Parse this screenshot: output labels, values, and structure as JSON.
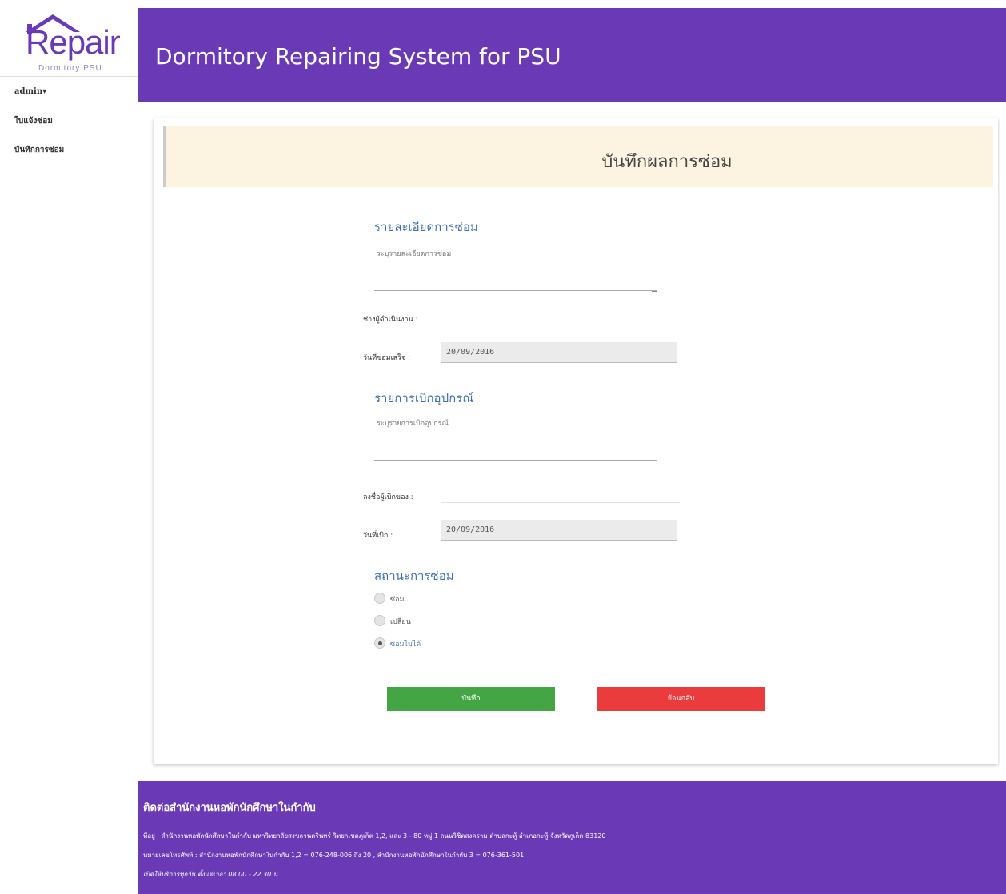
{
  "brand": {
    "logo_text": "Repair",
    "logo_subtext": "Dormitory PSU"
  },
  "sidebar": {
    "user": "admin▾",
    "items": [
      {
        "label": "ใบแจ้งซ่อม"
      },
      {
        "label": "บันทึกการซ่อม"
      }
    ]
  },
  "header": {
    "title": "Dormitory Repairing System for PSU"
  },
  "form": {
    "title": "บันทึกผลการซ่อม",
    "repair_details": {
      "heading": "รายละเอียดการซ่อม",
      "placeholder": "ระบุรายละเอียดการซ่อม"
    },
    "technician": {
      "label": "ช่างผู้ดำเนินงาน :",
      "value": ""
    },
    "repair_done_date": {
      "label": "วันที่ซ่อมเสร็จ :",
      "value": "20/09/2016"
    },
    "equipment_list": {
      "heading": "รายการเบิกอุปกรณ์",
      "placeholder": "ระบุรายการเบิกอุปกรณ์"
    },
    "withdrawer": {
      "label": "ลงชื่อผู้เบิกของ :",
      "value": ""
    },
    "withdraw_date": {
      "label": "วันที่เบิก :",
      "value": "20/09/2016"
    },
    "status": {
      "heading": "สถานะการซ่อม",
      "options": [
        {
          "label": "ซ่อม",
          "checked": false
        },
        {
          "label": "เปลี่ยน",
          "checked": false
        },
        {
          "label": "ซ่อมไม่ได้",
          "checked": true
        }
      ]
    },
    "buttons": {
      "save": "บันทึก",
      "back": "ย้อนกลับ"
    }
  },
  "footer": {
    "title": "ติดต่อสำนักงานหอพักนักศึกษาในกำกับ",
    "address": "ที่อยู่ : สำนักงานหอพักนักศึกษาในกำกับ มหาวิทยาลัยสงขลานครินทร์ วิทยาเขตภูเก็ต 1,2, และ 3 - 80 หมู่ 1 ถนนวิชิตสงคราม ตำบลกะทู้ อำเภอกะทู้ จังหวัดภูเก็ต 83120",
    "phone": "หมายเลขโทรศัพท์ : สำนักงานหอพักนักศึกษาในกำกับ 1,2 = 076-248-006 ถึง 20 , สำนักงานหอพักนักศึกษาในกำกับ 3 = 076-361-501",
    "hours": "เปิดให้บริการทุกวัน ตั้งแต่เวลา 08.00 - 22.30 น."
  },
  "colors": {
    "primary": "#6a3ab6",
    "banner_bg": "#fcf3e1",
    "save_button": "#43a544",
    "back_button": "#ea3c3c",
    "heading_blue": "#3b6fae"
  }
}
